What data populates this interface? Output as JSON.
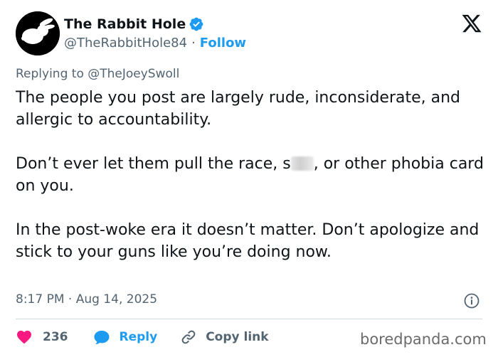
{
  "author": {
    "display_name": "The Rabbit Hole",
    "handle": "@TheRabbitHole84",
    "separator": "·",
    "follow_label": "Follow",
    "avatar_icon": "rabbit-logo",
    "verified_icon": "verified-badge-icon"
  },
  "platform_icon": "x-logo-icon",
  "reply": {
    "prefix": "Replying to",
    "target": "@TheJoeySwoll"
  },
  "body": {
    "p1": "The people you post are largely rude, inconsiderate, and allergic to accountability.",
    "p2_before": "Don’t ever let them pull the race, s",
    "p2_after": ", or other phobia card on you.",
    "p3": "In the post-woke era it doesn’t matter. Don’t apologize and stick to your guns like you’re doing now."
  },
  "meta": {
    "timestamp": "8:17 PM · Aug 14, 2025"
  },
  "actions": {
    "like_count": "236",
    "reply_label": "Reply",
    "copy_label": "Copy link"
  },
  "watermark": "boredpanda.com",
  "colors": {
    "accent": "#1d9bf0",
    "like": "#f91880",
    "text": "#0f1419",
    "muted": "#536471"
  }
}
